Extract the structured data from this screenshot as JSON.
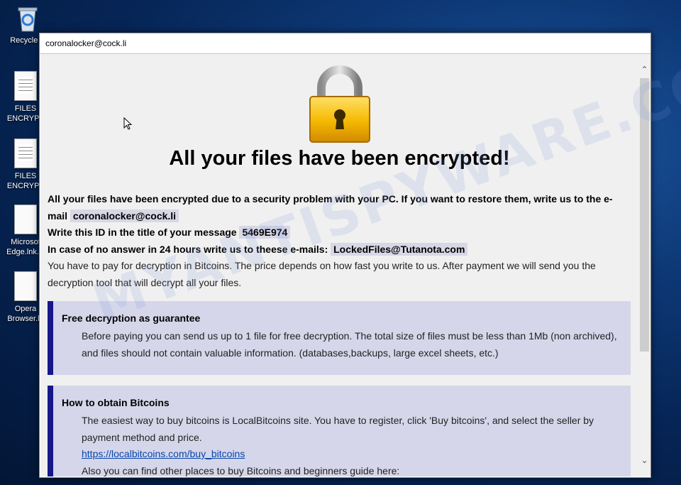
{
  "desktop": {
    "icons": [
      {
        "label": "Recycle B",
        "glyph": "recycle-bin-icon"
      },
      {
        "label": "FILES ENCRYPT",
        "glyph": "text-file-icon"
      },
      {
        "label": "FILES ENCRYPT",
        "glyph": "text-file-icon"
      },
      {
        "label": "Microsof Edge.lnk.ic",
        "glyph": "blank-file-icon"
      },
      {
        "label": "Opera Browser.ln",
        "glyph": "blank-file-icon"
      }
    ]
  },
  "window": {
    "title": "coronalocker@cock.li",
    "headline": "All your files have been encrypted!",
    "intro": {
      "line1": "All your files have been encrypted due to a security problem with your PC. If you want to restore them, write us to the e-mail",
      "email": "coronalocker@cock.li",
      "id_label": "Write this ID in the title of your message",
      "id_value": "5469E974",
      "alt_label": "In case of no answer in 24 hours write us to theese e-mails:",
      "alt_email": "LockedFiles@Tutanota.com",
      "pay_text": "You have to pay for decryption in Bitcoins. The price depends on how fast you write to us. After payment we will send you the decryption tool that will decrypt all your files."
    },
    "guarantee": {
      "title": "Free decryption as guarantee",
      "text": "Before paying you can send us up to 1 file for free decryption. The total size of files must be less than 1Mb (non archived), and files should not contain valuable information. (databases,backups, large excel sheets, etc.)"
    },
    "bitcoins": {
      "title": "How to obtain Bitcoins",
      "text": "The easiest way to buy bitcoins is LocalBitcoins site. You have to register, click 'Buy bitcoins', and select the seller by payment method and price.",
      "link": "https://localbitcoins.com/buy_bitcoins",
      "more": "Also you can find other places to buy Bitcoins and beginners guide here:"
    },
    "scrollbar": {
      "up": "⌃",
      "down": "⌄"
    }
  },
  "watermark": "MYANTISPYWARE.COM"
}
